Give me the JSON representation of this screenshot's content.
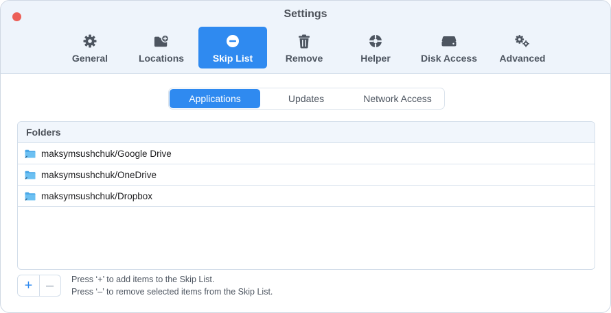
{
  "window": {
    "title": "Settings"
  },
  "toolbar": {
    "items": [
      {
        "label": "General",
        "icon": "gear-icon"
      },
      {
        "label": "Locations",
        "icon": "folder-add-icon"
      },
      {
        "label": "Skip List",
        "icon": "minus-circle-icon",
        "active": true
      },
      {
        "label": "Remove",
        "icon": "trash-icon"
      },
      {
        "label": "Helper",
        "icon": "helper-icon"
      },
      {
        "label": "Disk Access",
        "icon": "disk-icon"
      },
      {
        "label": "Advanced",
        "icon": "gears-icon"
      }
    ]
  },
  "tabs": {
    "items": [
      {
        "label": "Applications",
        "active": true
      },
      {
        "label": "Updates"
      },
      {
        "label": "Network Access"
      }
    ]
  },
  "folders": {
    "header": "Folders",
    "rows": [
      {
        "path": "maksymsushchuk/Google Drive"
      },
      {
        "path": "maksymsushchuk/OneDrive"
      },
      {
        "path": "maksymsushchuk/Dropbox"
      }
    ]
  },
  "actions": {
    "add_label": "+",
    "remove_label": "–"
  },
  "hints": {
    "add": "Press ‘+’ to add items to the Skip List.",
    "remove": "Press ‘–’ to remove selected items from the Skip List."
  },
  "colors": {
    "accent": "#2f8af0",
    "close": "#ec5f57",
    "toolbar_bg": "#eef4fb",
    "folder": "#4aa8e8"
  }
}
